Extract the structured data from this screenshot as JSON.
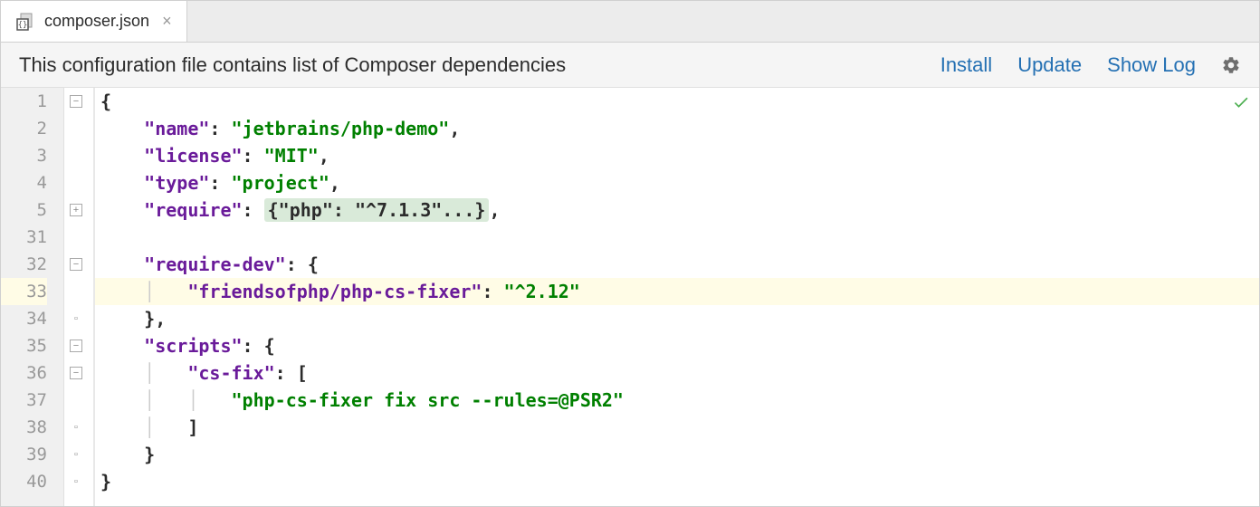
{
  "tab": {
    "filename": "composer.json",
    "close_glyph": "×"
  },
  "notification": {
    "text": "This configuration file contains list of Composer dependencies",
    "actions": {
      "install": "Install",
      "update": "Update",
      "show_log": "Show Log"
    }
  },
  "code": {
    "lines": [
      {
        "n": "1",
        "fold": "minus"
      },
      {
        "n": "2"
      },
      {
        "n": "3"
      },
      {
        "n": "4"
      },
      {
        "n": "5",
        "fold": "plus"
      },
      {
        "n": "31"
      },
      {
        "n": "32",
        "fold": "minus"
      },
      {
        "n": "33",
        "highlight": true
      },
      {
        "n": "34",
        "fold": "close"
      },
      {
        "n": "35",
        "fold": "minus"
      },
      {
        "n": "36",
        "fold": "minus"
      },
      {
        "n": "37"
      },
      {
        "n": "38",
        "fold": "close"
      },
      {
        "n": "39",
        "fold": "close"
      },
      {
        "n": "40",
        "fold": "close"
      }
    ],
    "tokens": {
      "brace_open": "{",
      "brace_close": "}",
      "bracket_open": "[",
      "bracket_close": "]",
      "comma": ",",
      "colon": ":",
      "name_key": "\"name\"",
      "name_val": "\"jetbrains/php-demo\"",
      "license_key": "\"license\"",
      "license_val": "\"MIT\"",
      "type_key": "\"type\"",
      "type_val": "\"project\"",
      "require_key": "\"require\"",
      "require_folded": "{\"php\": \"^7.1.3\"...}",
      "require_dev_key": "\"require-dev\"",
      "fixer_key": "\"friendsofphp/php-cs-fixer\"",
      "fixer_val": "\"^2.12\"",
      "scripts_key": "\"scripts\"",
      "csfix_key": "\"cs-fix\"",
      "csfix_val": "\"php-cs-fixer fix src --rules=@PSR2\""
    }
  }
}
